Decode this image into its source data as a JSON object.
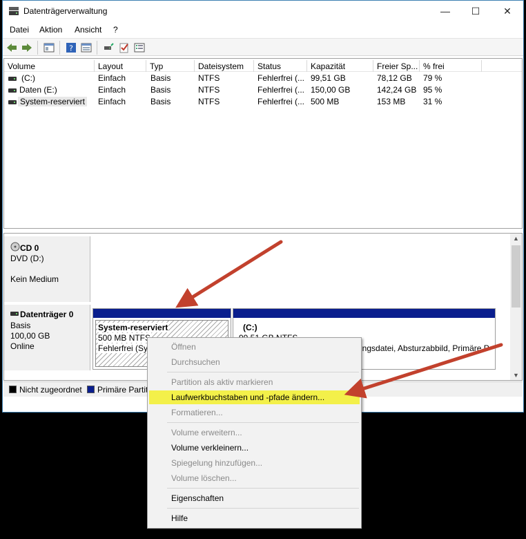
{
  "window": {
    "title": "Datenträgerverwaltung",
    "minimize_glyph": "—",
    "maximize_glyph": "☐",
    "close_glyph": "✕"
  },
  "menu": [
    "Datei",
    "Aktion",
    "Ansicht",
    "?"
  ],
  "toolbar": {
    "icons": [
      "back-icon",
      "forward-icon",
      "console-tree-icon",
      "help-icon",
      "properties-icon",
      "connect-icon",
      "check-icon",
      "list-icon"
    ]
  },
  "volume_list": {
    "columns": [
      "Volume",
      "Layout",
      "Typ",
      "Dateisystem",
      "Status",
      "Kapazität",
      "Freier Sp...",
      "% frei"
    ],
    "rows": [
      {
        "volume": "(C:)",
        "layout": "Einfach",
        "typ": "Basis",
        "fs": "NTFS",
        "status": "Fehlerfrei (...",
        "kapazitaet": "99,51 GB",
        "frei": "78,12 GB",
        "prozent": "79 %"
      },
      {
        "volume": "Daten (E:)",
        "layout": "Einfach",
        "typ": "Basis",
        "fs": "NTFS",
        "status": "Fehlerfrei (...",
        "kapazitaet": "150,00 GB",
        "frei": "142,24 GB",
        "prozent": "95 %"
      },
      {
        "volume": "System-reserviert",
        "layout": "Einfach",
        "typ": "Basis",
        "fs": "NTFS",
        "status": "Fehlerfrei (...",
        "kapazitaet": "500 MB",
        "frei": "153 MB",
        "prozent": "31 %"
      }
    ]
  },
  "disks": {
    "cd0": {
      "name": "CD 0",
      "type": "DVD (D:)",
      "media": "Kein Medium"
    },
    "disk0": {
      "name": "Datenträger 0",
      "type": "Basis",
      "size": "100,00 GB",
      "state": "Online",
      "partitions": [
        {
          "name": "System-reserviert",
          "size": "500 MB NTFS",
          "status": "Fehlerfrei (Sys"
        },
        {
          "name": "(C:)",
          "size": "99,51 GB NTFS",
          "status": "ungsdatei, Absturzabbild, Primäre P"
        }
      ]
    }
  },
  "legend": [
    {
      "label": "Nicht zugeordnet",
      "color": "#000000"
    },
    {
      "label": "Primäre Partit",
      "color": "#0a1e8e"
    }
  ],
  "context_menu": {
    "groups": [
      [
        {
          "label": "Öffnen",
          "enabled": false
        },
        {
          "label": "Durchsuchen",
          "enabled": false
        }
      ],
      [
        {
          "label": "Partition als aktiv markieren",
          "enabled": false
        },
        {
          "label": "Laufwerkbuchstaben und -pfade ändern...",
          "enabled": true,
          "highlighted": true
        },
        {
          "label": "Formatieren...",
          "enabled": false
        }
      ],
      [
        {
          "label": "Volume erweitern...",
          "enabled": false
        },
        {
          "label": "Volume verkleinern...",
          "enabled": true
        },
        {
          "label": "Spiegelung hinzufügen...",
          "enabled": false
        },
        {
          "label": "Volume löschen...",
          "enabled": false
        }
      ],
      [
        {
          "label": "Eigenschaften",
          "enabled": true
        }
      ],
      [
        {
          "label": "Hilfe",
          "enabled": true
        }
      ]
    ]
  },
  "colors": {
    "partition_primary": "#0a1e8e",
    "highlight": "#f3f04a",
    "annotation_arrow": "#c2412d",
    "window_border": "#3c7fb1"
  }
}
